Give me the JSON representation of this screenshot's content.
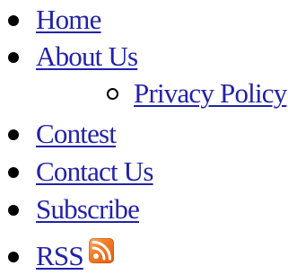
{
  "menu": {
    "items": [
      {
        "label": "Home"
      },
      {
        "label": "About Us",
        "children": [
          {
            "label": "Privacy Policy"
          }
        ]
      },
      {
        "label": "Contest"
      },
      {
        "label": "Contact Us"
      },
      {
        "label": "Subscribe"
      },
      {
        "label": "RSS",
        "icon": "rss-icon"
      }
    ]
  },
  "colors": {
    "link": "#2222aa",
    "bullet": "#000000",
    "rss_orange": "#f07b24"
  }
}
